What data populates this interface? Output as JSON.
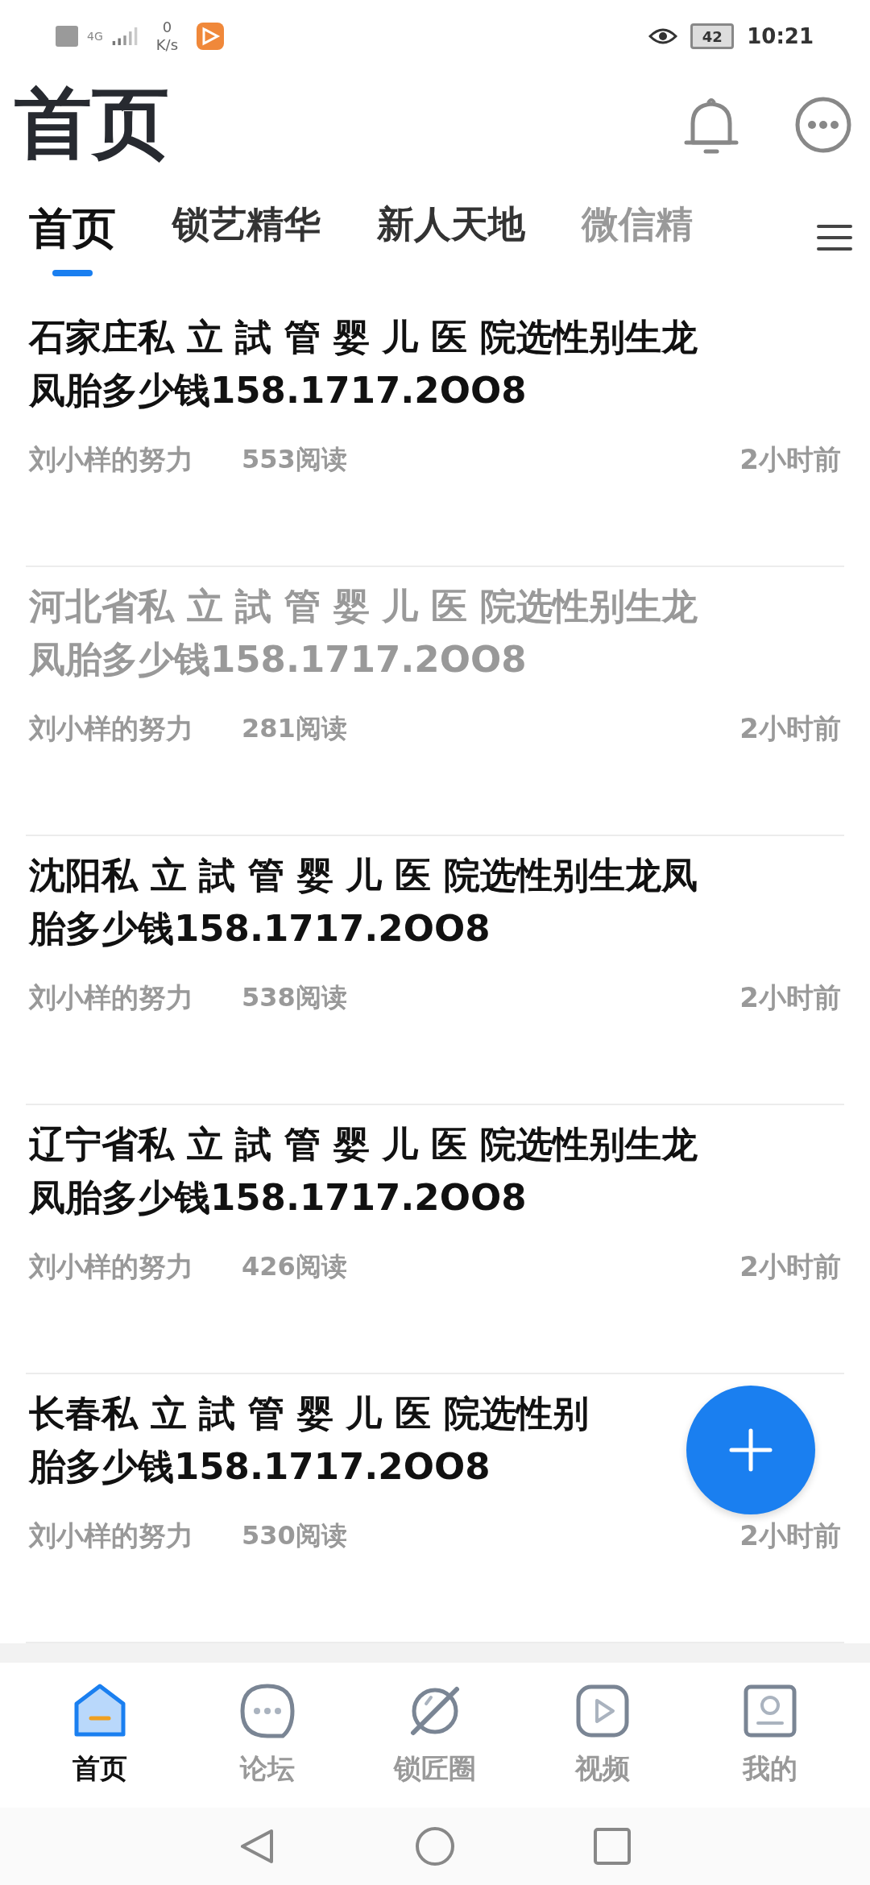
{
  "status_bar": {
    "network": "4G",
    "speed_value": "0",
    "speed_unit": "K/s",
    "battery": "42",
    "time": "10:21"
  },
  "header": {
    "title": "首页"
  },
  "tabs": [
    {
      "label": "首页",
      "selected": true
    },
    {
      "label": "锁艺精华",
      "selected": false
    },
    {
      "label": "新人天地",
      "selected": false
    },
    {
      "label": "微信精",
      "selected": false
    }
  ],
  "articles": [
    {
      "title_lines": [
        "石家庄私 立 試 管 婴 儿 医 院选性别生龙",
        "凤胎多少钱158.1717.2OO8"
      ],
      "author": "刘小样的努力",
      "reads": "553阅读",
      "time": "2小时前",
      "read": false
    },
    {
      "title_lines": [
        "河北省私 立 試 管 婴 儿 医 院选性别生龙",
        "凤胎多少钱158.1717.2OO8"
      ],
      "author": "刘小样的努力",
      "reads": "281阅读",
      "time": "2小时前",
      "read": true
    },
    {
      "title_lines": [
        "沈阳私 立 試 管 婴 儿 医 院选性别生龙凤",
        "胎多少钱158.1717.2OO8"
      ],
      "author": "刘小样的努力",
      "reads": "538阅读",
      "time": "2小时前",
      "read": false
    },
    {
      "title_lines": [
        "辽宁省私 立 試 管 婴 儿 医 院选性别生龙",
        "凤胎多少钱158.1717.2OO8"
      ],
      "author": "刘小样的努力",
      "reads": "426阅读",
      "time": "2小时前",
      "read": false
    },
    {
      "title_lines": [
        "长春私 立 試 管 婴 儿 医 院选性别",
        "胎多少钱158.1717.2OO8"
      ],
      "author": "刘小样的努力",
      "reads": "530阅读",
      "time": "2小时前",
      "read": false
    }
  ],
  "bottom_nav": [
    {
      "label": "首页",
      "kind": "home",
      "selected": true
    },
    {
      "label": "论坛",
      "kind": "forum",
      "selected": false
    },
    {
      "label": "锁匠圈",
      "kind": "circle",
      "selected": false
    },
    {
      "label": "视频",
      "kind": "video",
      "selected": false
    },
    {
      "label": "我的",
      "kind": "profile",
      "selected": false
    }
  ]
}
